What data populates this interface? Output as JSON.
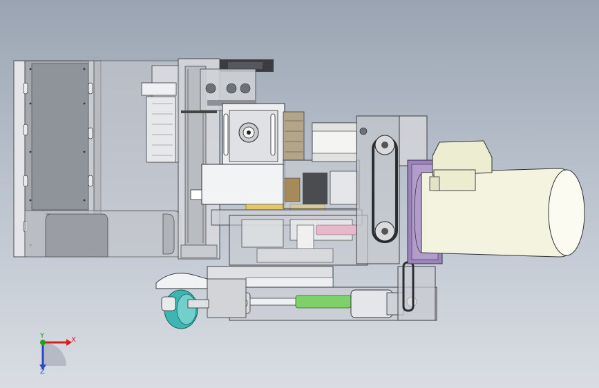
{
  "viewport": {
    "background_top": "#9aa4b2",
    "background_bottom": "#d9dde3"
  },
  "triad": {
    "x_label": "X",
    "y_label": "Y",
    "z_label": "Z",
    "x_color": "#d81e1e",
    "y_color": "#1fa21f",
    "z_color": "#2848c8"
  },
  "colors": {
    "motor_body": "#f4f3e0",
    "motor_flange": "#9b84b8",
    "housing_dark": "#3a3c40",
    "panel_grey": "#8f949b",
    "green_shaft": "#7fcf6a",
    "teal_wheel": "#3db5b0",
    "transparent_housing": "#c9ccd2"
  },
  "icons": [
    "view-triad-icon"
  ]
}
